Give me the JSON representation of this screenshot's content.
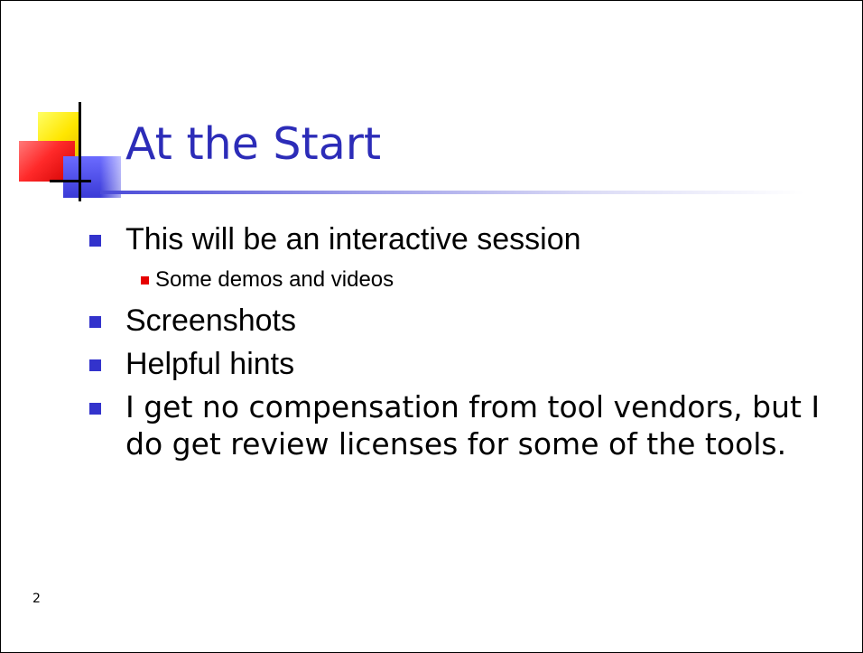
{
  "slide": {
    "title": "At the Start",
    "bullets": [
      {
        "text": "This will be an interactive session",
        "sub": [
          "Some demos and videos"
        ]
      },
      {
        "text": "Screenshots"
      },
      {
        "text": "Helpful hints"
      },
      {
        "text": "I get no compensation from tool vendors, but I do get review licenses for some of the tools."
      }
    ],
    "page_number": "2"
  },
  "colors": {
    "title": "#2c2cb8",
    "bullet_primary": "#3333cc",
    "bullet_secondary": "#e60000"
  }
}
